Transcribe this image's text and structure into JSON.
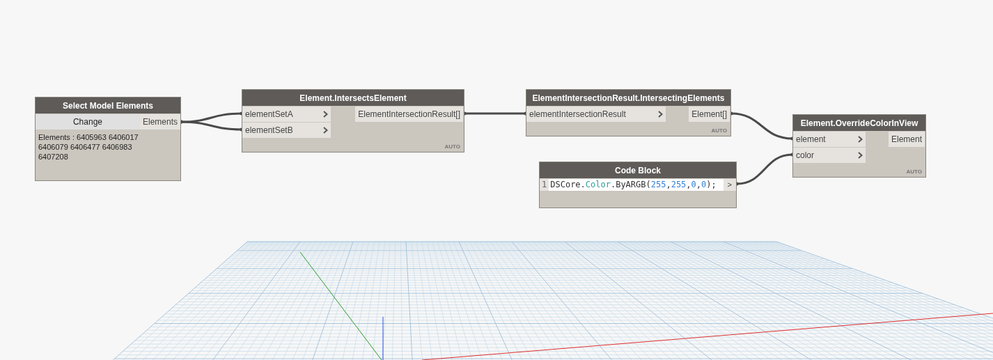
{
  "nodes": [
    {
      "kind": "selection",
      "title": "Select Model Elements",
      "button": "Change",
      "outputs": [
        "Elements"
      ],
      "body": "Elements : 6405963 6406017 6406079 6406477 6406983 6407208"
    },
    {
      "kind": "function",
      "title": "Element.IntersectsElement",
      "inputs": [
        "elementSetA",
        "elementSetB"
      ],
      "outputs": [
        "ElementIntersectionResult[]"
      ],
      "lacing": "AUTO"
    },
    {
      "kind": "function",
      "title": "ElementIntersectionResult.IntersectingElements",
      "inputs": [
        "elementIntersectionResult"
      ],
      "outputs": [
        "Element[]"
      ],
      "lacing": "AUTO"
    },
    {
      "kind": "code",
      "title": "Code Block",
      "line_number": "1",
      "code_tokens": [
        {
          "text": "DSCore.",
          "kind": "plain"
        },
        {
          "text": "Color",
          "kind": "type"
        },
        {
          "text": ".ByARGB(",
          "kind": "plain"
        },
        {
          "text": "255",
          "kind": "number"
        },
        {
          "text": ",",
          "kind": "plain"
        },
        {
          "text": "255",
          "kind": "number"
        },
        {
          "text": ",",
          "kind": "plain"
        },
        {
          "text": "0",
          "kind": "number"
        },
        {
          "text": ",",
          "kind": "plain"
        },
        {
          "text": "0",
          "kind": "number"
        },
        {
          "text": ");",
          "kind": "plain"
        }
      ],
      "outputs": [
        ">"
      ]
    },
    {
      "kind": "function",
      "title": "Element.OverrideColorInView",
      "inputs": [
        "element",
        "color"
      ],
      "outputs": [
        "Element"
      ],
      "lacing": "AUTO"
    }
  ]
}
